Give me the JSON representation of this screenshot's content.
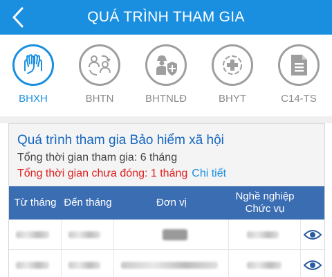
{
  "header": {
    "title": "QUÁ TRÌNH THAM GIA"
  },
  "tabs": [
    {
      "label": "BHXH",
      "icon": "hands-icon",
      "active": true
    },
    {
      "label": "BHTN",
      "icon": "people-cycle-icon",
      "active": false
    },
    {
      "label": "BHTNLĐ",
      "icon": "worker-shield-icon",
      "active": false
    },
    {
      "label": "BHYT",
      "icon": "medical-cross-icon",
      "active": false
    },
    {
      "label": "C14-TS",
      "icon": "document-icon",
      "active": false
    }
  ],
  "summary": {
    "title": "Quá trình tham gia Bảo hiểm xã hội",
    "total_time": "Tổng thời gian tham gia: 6 tháng",
    "unpaid_time": "Tổng thời gian chưa đóng: 1 tháng",
    "detail_link": "Chi tiết"
  },
  "table": {
    "headers": {
      "from_month": "Từ tháng",
      "to_month": "Đến tháng",
      "unit": "Đơn vị",
      "occupation": "Nghề nghiệp",
      "position": "Chức vụ"
    },
    "rows": [
      {
        "note": "redacted"
      },
      {
        "note": "redacted"
      }
    ]
  },
  "colors": {
    "accent": "#1a8fe0",
    "table_header": "#3b6db3",
    "warning": "#e02020",
    "inactive": "#9e9e9e"
  }
}
